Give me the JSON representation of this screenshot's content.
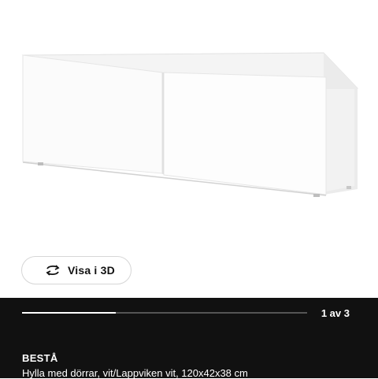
{
  "gallery": {
    "view_3d_label": "Visa i 3D",
    "pager_text": "1 av 3",
    "progress_fraction": 0.33,
    "product_image": "white-shelf-unit-with-doors"
  },
  "product": {
    "name": "BESTÅ",
    "description": "Hylla med dörrar, vit/Lappviken vit, 120x42x38 cm"
  },
  "colors": {
    "panel_background": "#111111",
    "progress_track": "#555555",
    "progress_fill": "#ffffff"
  }
}
